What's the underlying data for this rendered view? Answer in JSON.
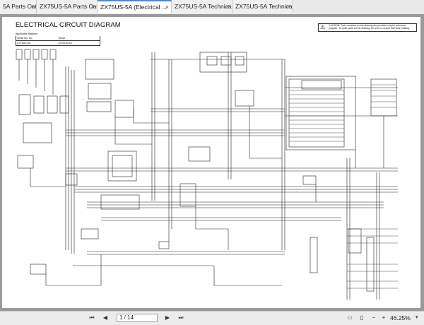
{
  "tabs": [
    {
      "label": "5A Parts Cata...",
      "active": false
    },
    {
      "label": "ZX75US-5A Parts Cata...",
      "active": false
    },
    {
      "label": "ZX75US-5A (Electrical ...",
      "active": true
    },
    {
      "label": "ZX75US-5A Technical ...",
      "active": false
    },
    {
      "label": "ZX75US-5A Technical ...",
      "active": false
    }
  ],
  "tab_close_glyph": "×",
  "document": {
    "title": "ELECTRICAL CIRCUIT DIAGRAM",
    "caution": "CAUTION: Parts numbers on the drawing are provided only for reference purpose. To order parts on the drawing, be sure to consult the Parts Catalog.",
    "caution_icon": "warning-triangle-icon",
    "applicable": {
      "heading": "Applicable Machine",
      "rows": [
        {
          "label": "Serial No. No.",
          "value": "Serial"
        },
        {
          "label": "ZX75US-5A",
          "value": "ZX75US-5A"
        }
      ]
    }
  },
  "status": {
    "page_current": "1",
    "page_total": "14",
    "page_display": "1 / 14",
    "zoom": "46.25%"
  },
  "colors": {
    "accent": "#3c8de0",
    "canvas_bg": "#9a9a9a",
    "tab_bg": "#e9e9e9",
    "status_bg": "#ececec"
  },
  "icons": {
    "first_page": "first-page-icon",
    "prev_page": "prev-page-icon",
    "next_page": "next-page-icon",
    "last_page": "last-page-icon",
    "fit_page": "fit-page-icon",
    "fit_width": "fit-width-icon",
    "zoom_out": "zoom-out-icon",
    "zoom_in": "zoom-in-icon"
  }
}
